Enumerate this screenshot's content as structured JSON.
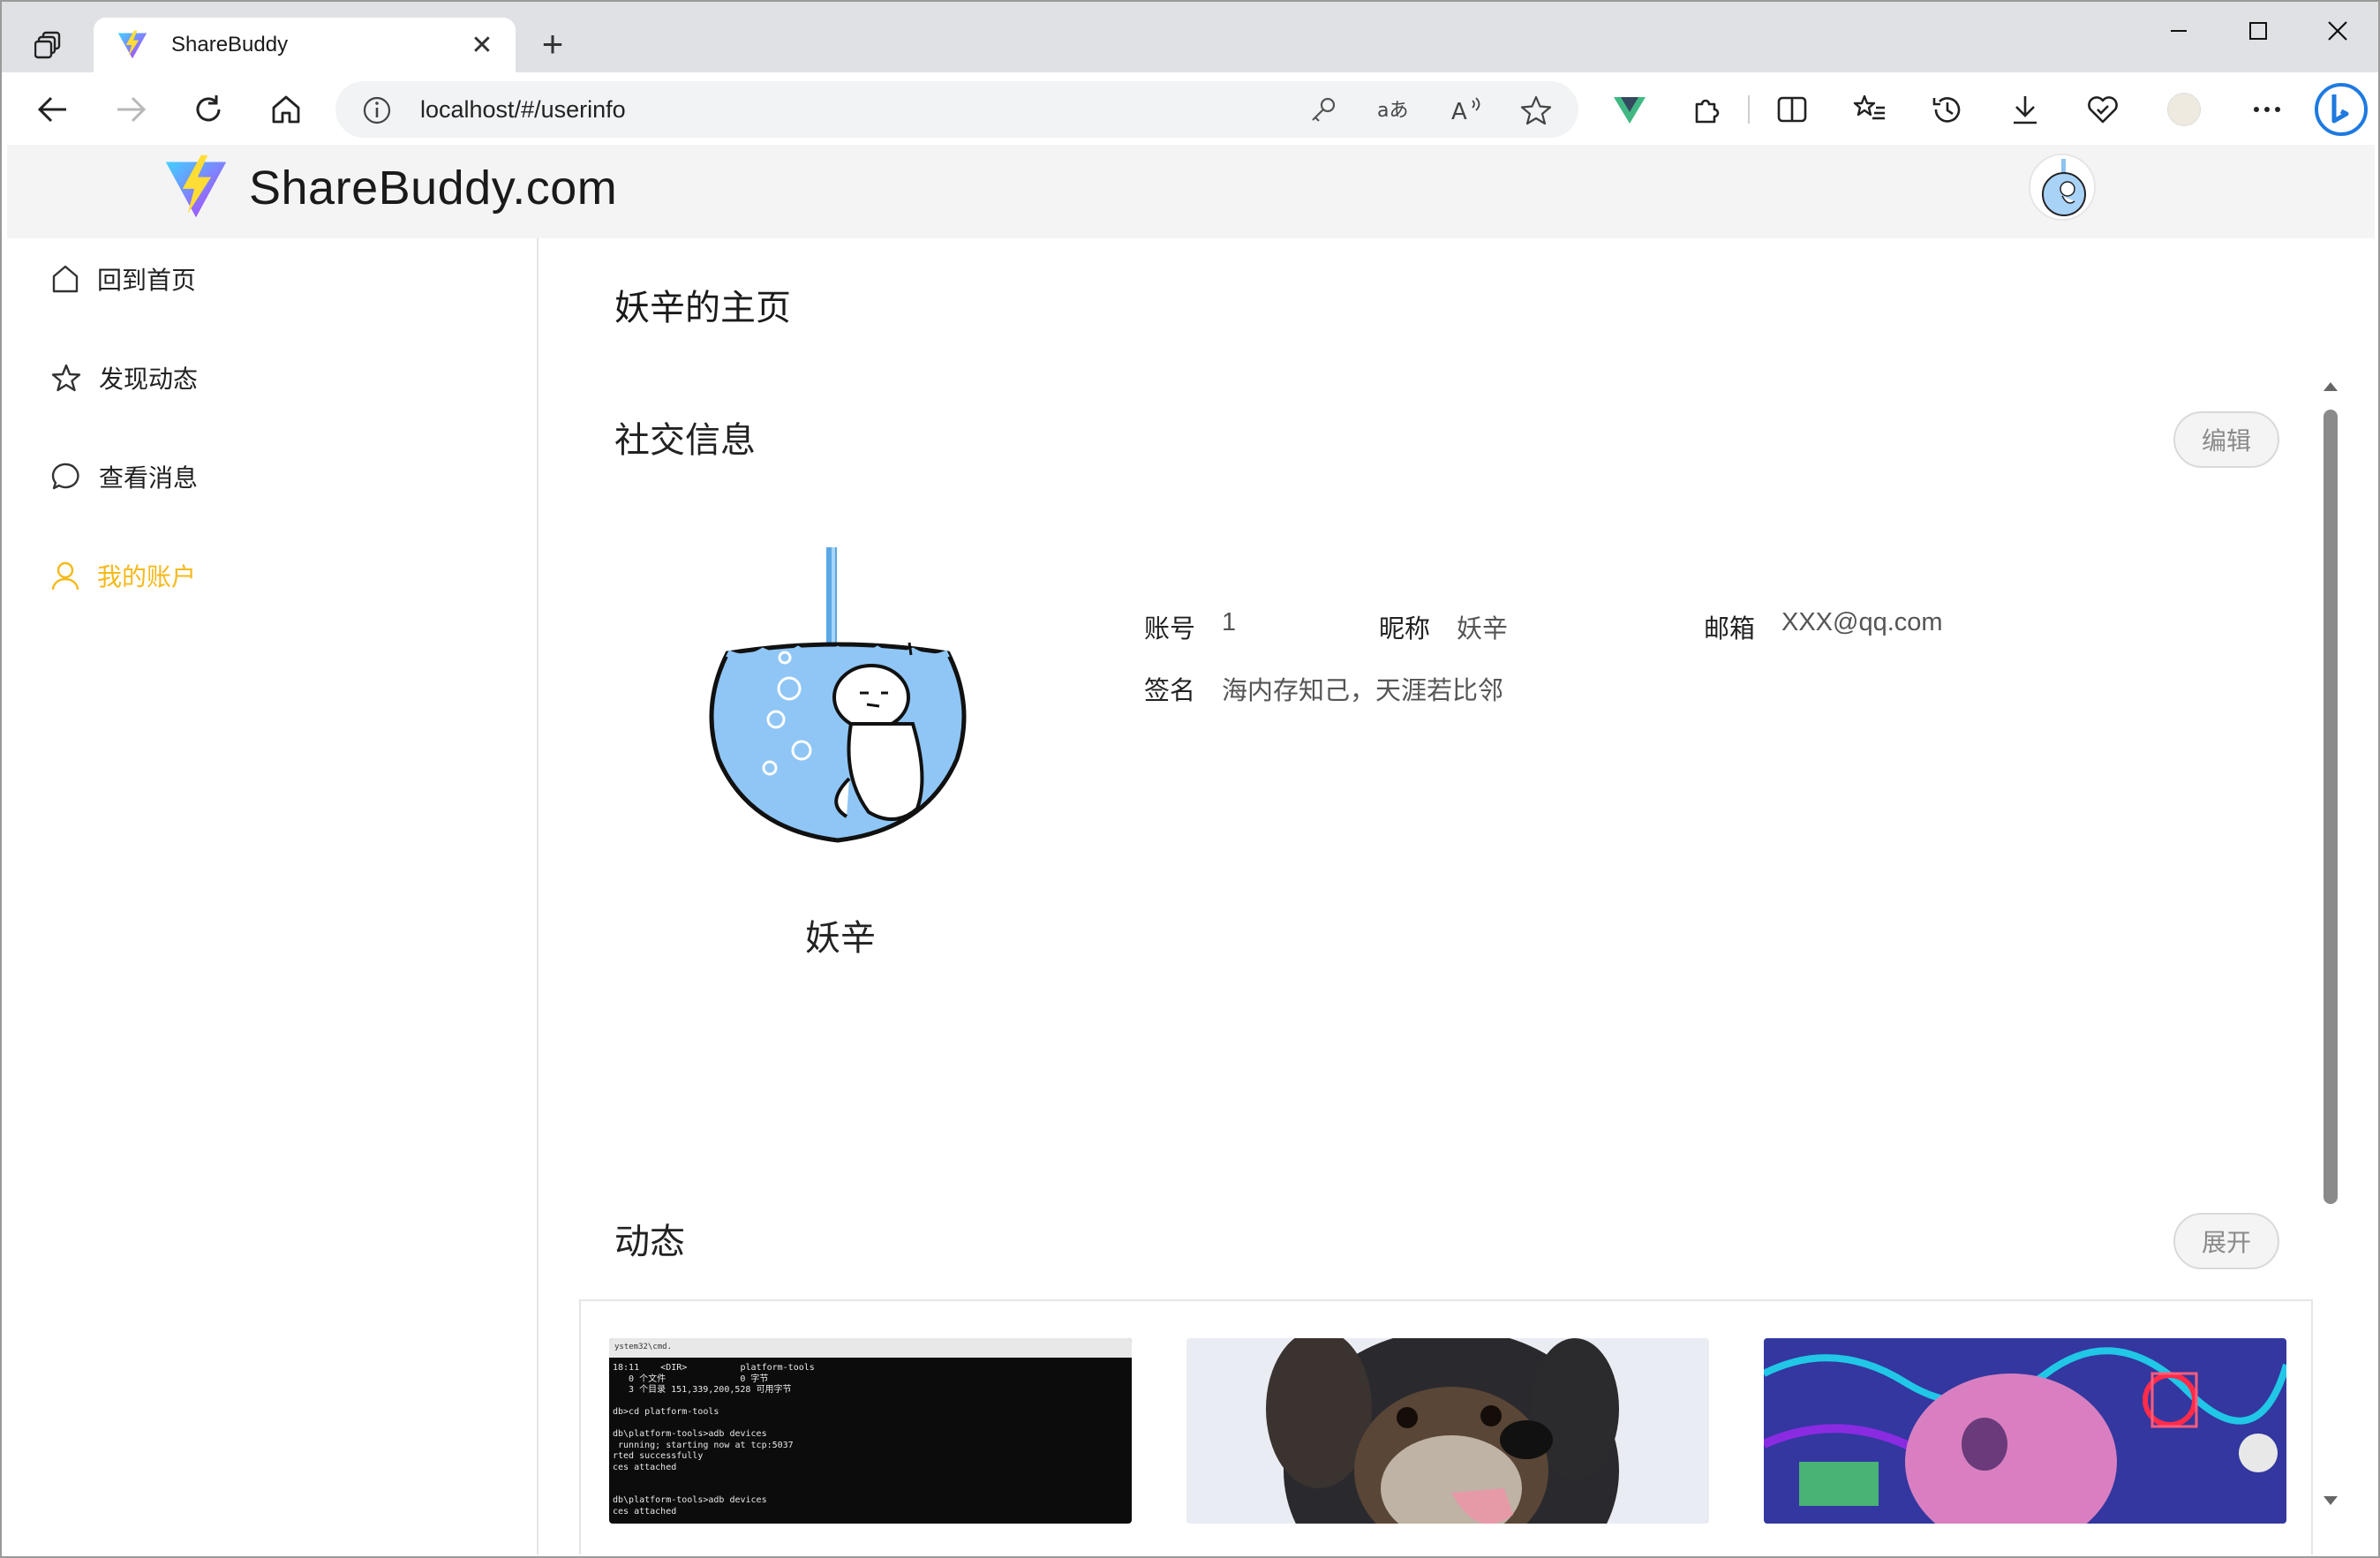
{
  "browser": {
    "tab_title": "ShareBuddy",
    "tab_close_glyph": "✕",
    "new_tab_glyph": "+",
    "url": "localhost/#/userinfo"
  },
  "header": {
    "brand": "ShareBuddy.com"
  },
  "sidebar": {
    "items": [
      {
        "label": "回到首页",
        "icon": "home-icon"
      },
      {
        "label": "发现动态",
        "icon": "star-icon"
      },
      {
        "label": "查看消息",
        "icon": "chat-bubble-icon"
      },
      {
        "label": "我的账户",
        "icon": "user-icon",
        "active": true
      }
    ],
    "active_color": "#f5b91a"
  },
  "main": {
    "page_title": "妖辛的主页",
    "social": {
      "title": "社交信息",
      "edit_label": "编辑",
      "avatar_name": "妖辛",
      "fields": {
        "account_label": "账号",
        "account_value": "1",
        "nickname_label": "昵称",
        "nickname_value": "妖辛",
        "email_label": "邮箱",
        "email_value": "XXX@qq.com",
        "signature_label": "签名",
        "signature_value": "海内存知己，天涯若比邻"
      }
    },
    "posts": {
      "title": "动态",
      "expand_label": "展开",
      "terminal_title": "ystem32\\cmd.",
      "terminal_text": "18:11    <DIR>          platform-tools\n   0 个文件              0 字节\n   3 个目录 151,339,200,528 可用字节\n\ndb>cd platform-tools\n\ndb\\platform-tools>adb devices\n running; starting now at tcp:5037\nrted successfully\nces attached\n\n\ndb\\platform-tools>adb devices\nces attached"
    }
  }
}
